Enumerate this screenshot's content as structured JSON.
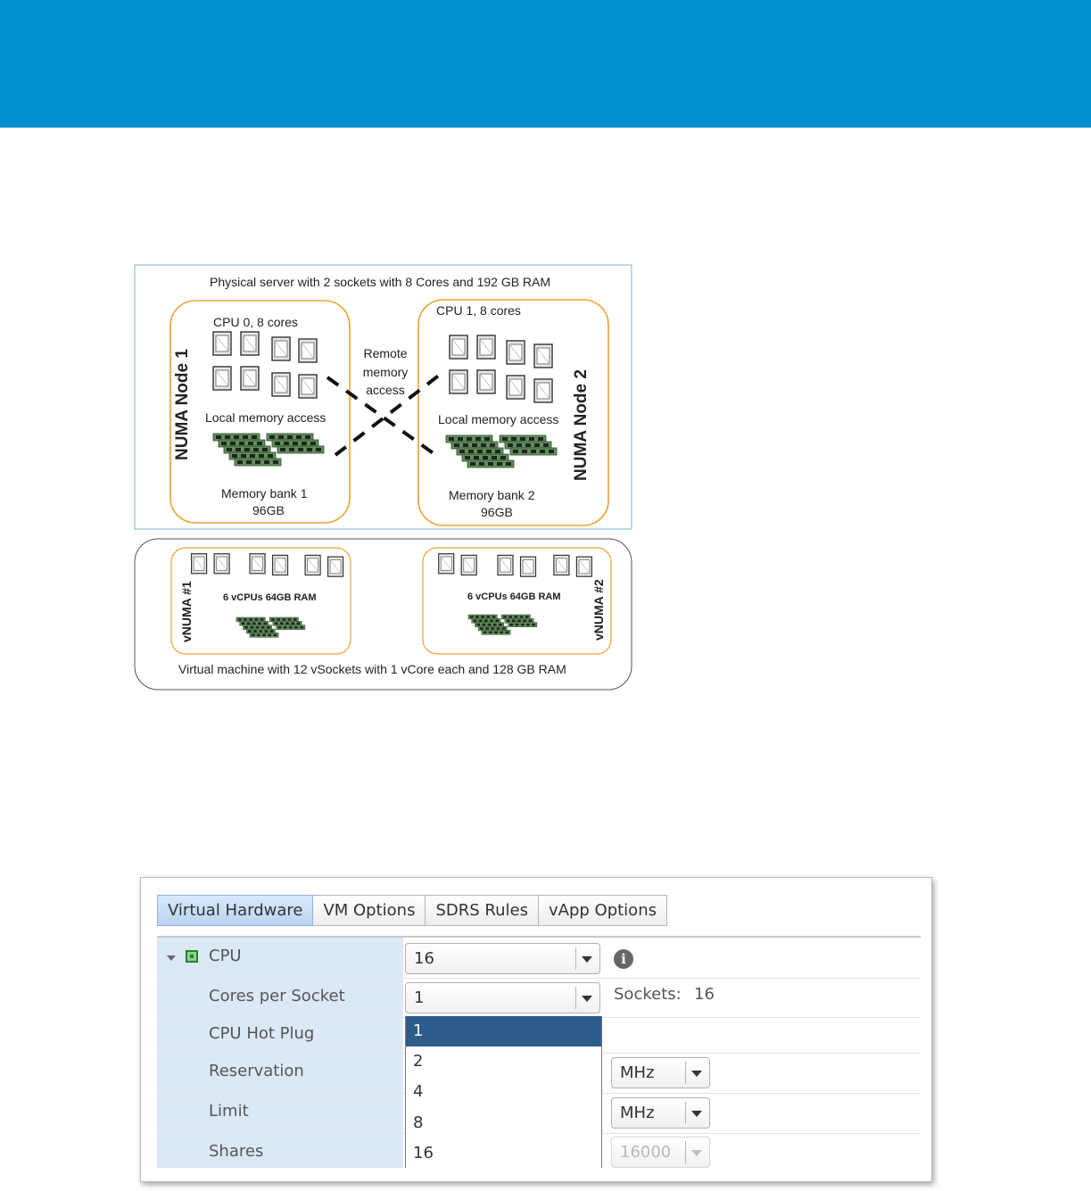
{
  "diagram": {
    "top_caption": "Physical server with 2 sockets with 8 Cores and 192 GB RAM",
    "node1": {
      "title": "NUMA Node 1",
      "cpu": "CPU 0, 8 cores",
      "local": "Local memory access",
      "bank": "Memory bank 1",
      "size": "96GB"
    },
    "node2": {
      "title": "NUMA Node 2",
      "cpu": "CPU 1, 8 cores",
      "local": "Local memory access",
      "bank": "Memory bank 2",
      "size": "96GB"
    },
    "remote": [
      "Remote",
      "memory",
      "access"
    ],
    "vnuma1": {
      "title": "vNUMA #1",
      "spec": "6 vCPUs 64GB RAM"
    },
    "vnuma2": {
      "title": "vNUMA #2",
      "spec": "6 vCPUs 64GB RAM"
    },
    "bottom_caption": "Virtual machine with 12 vSockets with 1 vCore each and 128 GB RAM"
  },
  "settings": {
    "tabs": [
      "Virtual Hardware",
      "VM Options",
      "SDRS Rules",
      "vApp Options"
    ],
    "active_tab": "Virtual Hardware",
    "rows": {
      "cpu": {
        "label": "CPU",
        "value": "16"
      },
      "cores": {
        "label": "Cores per Socket",
        "value": "1"
      },
      "sockets_label": "Sockets:",
      "sockets_value": "16",
      "hotplug": {
        "label": "CPU Hot Plug"
      },
      "reservation": {
        "label": "Reservation",
        "unit": "MHz"
      },
      "limit": {
        "label": "Limit",
        "unit": "MHz"
      },
      "shares": {
        "label": "Shares",
        "value": "16000"
      }
    },
    "cores_options": [
      "1",
      "2",
      "4",
      "8",
      "16"
    ],
    "cores_selected": "1"
  },
  "colors": {
    "header": "#0090d0",
    "numa_border": "#f0a030",
    "dropdown_selected": "#2e5c8a"
  }
}
